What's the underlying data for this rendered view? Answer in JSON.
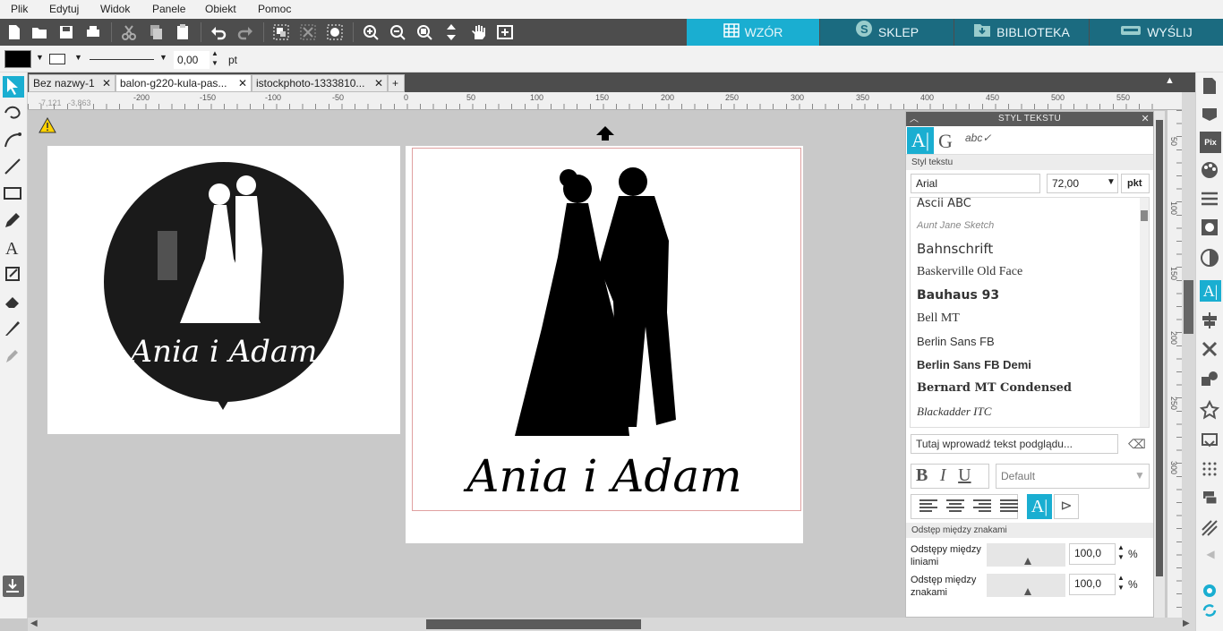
{
  "menu": [
    "Plik",
    "Edytuj",
    "Widok",
    "Panele",
    "Obiekt",
    "Pomoc"
  ],
  "nav_tabs": [
    {
      "label": "WZÓR",
      "active": true
    },
    {
      "label": "SKLEP",
      "active": false
    },
    {
      "label": "BIBLIOTEKA",
      "active": false
    },
    {
      "label": "WYŚLIJ",
      "active": false
    }
  ],
  "props": {
    "line_width": "0,00",
    "unit": "pt"
  },
  "doc_tabs": [
    "Bez nazwy-1",
    "balon-g220-kula-pas...",
    "istockphoto-1333810...",
    "+"
  ],
  "cursor_coords": {
    "x": "-7,121",
    "y": "-3,863"
  },
  "ruler_h": [
    "-200",
    "-150",
    "-100",
    "-50",
    "0",
    "50",
    "100",
    "150",
    "200",
    "250",
    "300",
    "350",
    "400",
    "450",
    "500",
    "550"
  ],
  "ruler_v": [
    "50",
    "100",
    "150",
    "200",
    "250",
    "300"
  ],
  "canvas": {
    "balloon_text": "Ania i Adam",
    "main_text": "Ania i Adam"
  },
  "panel": {
    "title": "STYL TEKSTU",
    "section1": "Styl tekstu",
    "font": "Arial",
    "size": "72,00",
    "size_unit": "pkt",
    "fonts": [
      "Ascii ABC",
      "Aunt Jane Sketch",
      "Bahnschrift",
      "Baskerville Old Face",
      "Bauhaus 93",
      "Bell MT",
      "Berlin Sans FB",
      "Berlin Sans FB Demi",
      "Bernard MT Condensed",
      "Blackadder ITC"
    ],
    "preview_placeholder": "Tutaj wprowadź tekst podglądu...",
    "style_select": "Default",
    "section2": "Odstęp między znakami",
    "line_spacing_label": "Odstępy między liniami",
    "line_spacing_value": "100,0",
    "char_spacing_label": "Odstęp między znakami",
    "char_spacing_value": "100,0",
    "percent": "%"
  },
  "colors": {
    "accent": "#1aaed1",
    "toolbar": "#4d4d4d",
    "nav_tabs": "#1b6b80"
  }
}
